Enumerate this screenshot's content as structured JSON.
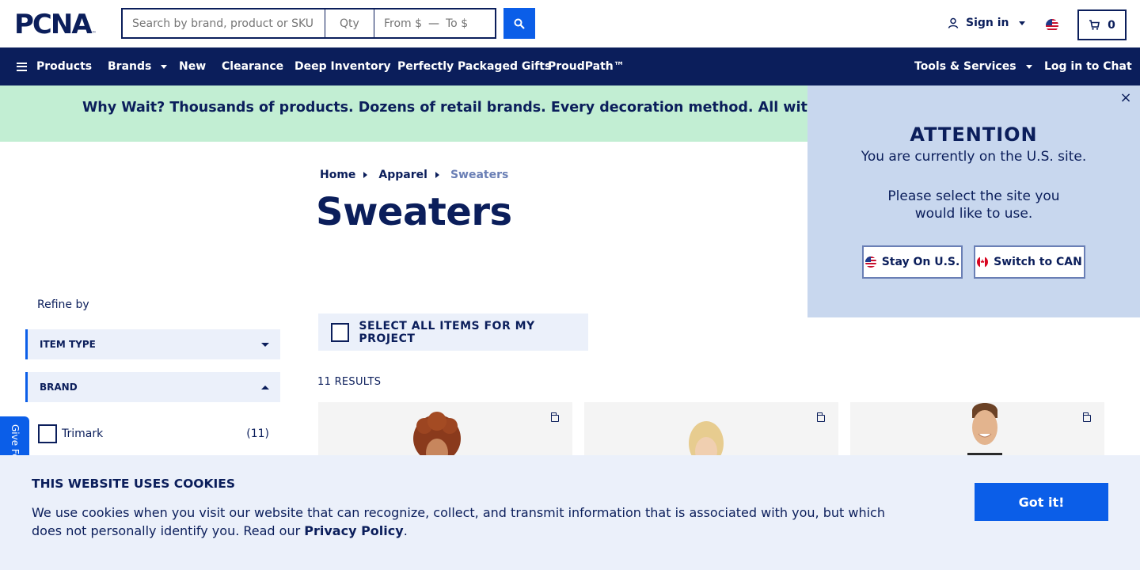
{
  "header": {
    "logo_text": "PCNA",
    "logo_tm": "™",
    "search_placeholder": "Search by brand, product or SKU",
    "qty_placeholder": "Qty",
    "price_from_placeholder": "From $",
    "price_dash": "—",
    "price_to_placeholder": "To $",
    "signin_label": "Sign in",
    "cart_count": "0"
  },
  "nav": {
    "products": "Products",
    "brands": "Brands",
    "new": "New",
    "clearance": "Clearance",
    "deep_inventory": "Deep Inventory",
    "gifts": "Perfectly Packaged Gifts",
    "proudpath": "ProudPath™",
    "tools": "Tools & Services",
    "chat": "Log in to Chat"
  },
  "promo": {
    "text": "Why Wait? Thousands of products. Dozens of retail brands. Every decoration method. All with a standard"
  },
  "breadcrumb": {
    "home": "Home",
    "apparel": "Apparel",
    "current": "Sweaters"
  },
  "page_title": "Sweaters",
  "sidebar": {
    "refine_label": "Refine by",
    "facets": [
      {
        "label": "ITEM TYPE",
        "expanded": false
      },
      {
        "label": "BRAND",
        "expanded": true
      }
    ],
    "brand_options": [
      {
        "label": "Trimark",
        "count": "(11)"
      }
    ],
    "feedback_label": "Give Feedback"
  },
  "results": {
    "select_all_label": "SELECT ALL ITEMS FOR MY PROJECT",
    "count_label": "11 RESULTS"
  },
  "modal": {
    "title": "ATTENTION",
    "line1": "You are currently on the U.S. site.",
    "line2": "Please select the site you",
    "line3": "would like to use.",
    "stay_label": "Stay On U.S.",
    "switch_label": "Switch to CAN",
    "close_glyph": "×"
  },
  "cookie": {
    "title": "THIS WEBSITE USES COOKIES",
    "body": "We use cookies when you visit our website that can recognize, collect, and transmit information that is associated with you, but which does not personally identify you. Read our",
    "link": "Privacy Policy",
    "period": ".",
    "button": "Got it!"
  },
  "colors": {
    "navy": "#0b1e5b",
    "blue": "#0b5ee8",
    "promo_green": "#c2eed3",
    "modal_bg": "#c8d7ee",
    "light_panel": "#ebf0fa"
  }
}
